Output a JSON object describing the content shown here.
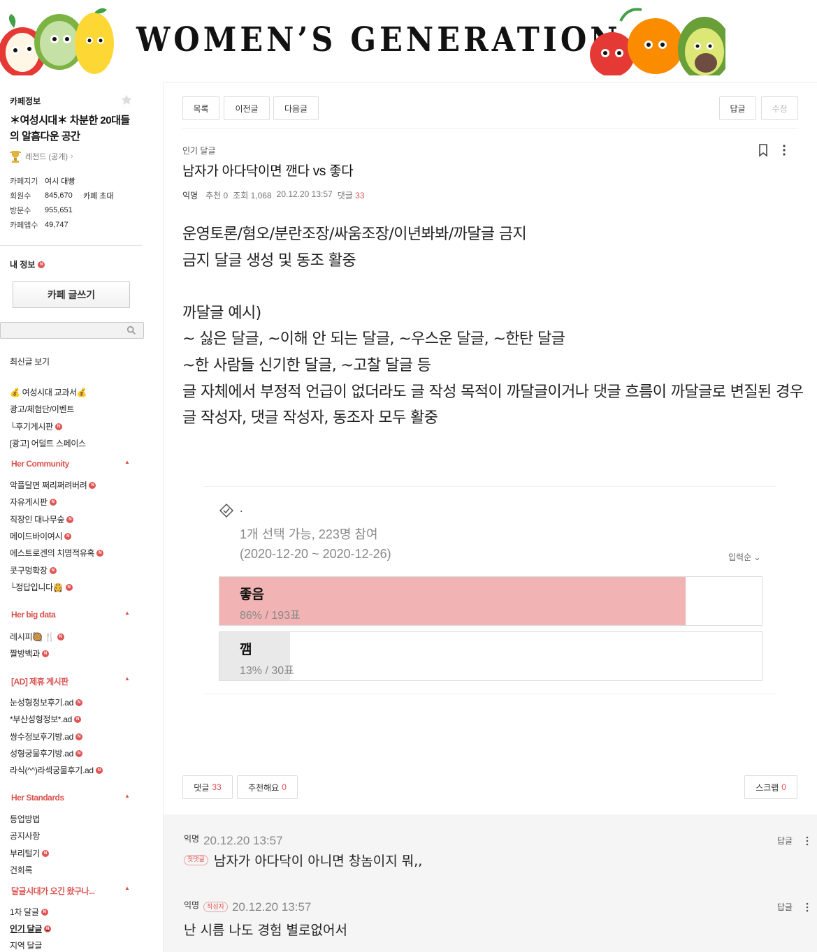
{
  "banner": {
    "title": "WOMEN’S GENERATION"
  },
  "sidebar": {
    "info_title": "카페정보",
    "cafe_name": "＊여성시대＊ 차분한 20대들의 알흠다운 공간",
    "legend": "레전드 (공개)",
    "stats": [
      {
        "label": "카페지기",
        "value": "여시 대빵",
        "extra": ""
      },
      {
        "label": "회원수",
        "value": "845,670",
        "extra": "카페 초대"
      },
      {
        "label": "방문수",
        "value": "955,651",
        "extra": ""
      },
      {
        "label": "카페앱수",
        "value": "49,747",
        "extra": ""
      }
    ],
    "my_info": "내 정보",
    "write_button": "카페 글쓰기",
    "latest": "최신글 보기",
    "links_top": [
      "💰 여성시대 교과서💰",
      "광고/체험단/이벤트",
      "└후기게시판",
      "[광고] 어덜트 스페이스"
    ],
    "group_her_community": "Her Community",
    "links_community": [
      "악플달면 쩌리쩌려버려",
      "자유게시판",
      "직장인 대나무숲",
      "메이드바이여시",
      "에스트로겐의 치명적유혹",
      "콧구멍확장",
      "└정답입니다👸"
    ],
    "group_her_big_data": "Her big data",
    "links_bigdata": [
      "레시피🥘 🍴",
      "짤방백과"
    ],
    "group_ad": "[AD] 제휴 게시판",
    "links_ad": [
      "눈성형정보후기.ad",
      "*부산성형정보*.ad",
      "쌍수정보후기방.ad",
      "성형궁물후기방.ad",
      "라식(^^)라섹궁물후기.ad"
    ],
    "group_standards": "Her Standards",
    "links_standards": [
      "등업방법",
      "공지사항",
      "부리털기",
      "건회록"
    ],
    "group_dalgeul": "달글시대가 오긴 왔구나...",
    "links_dalgeul": [
      "1차 달글",
      "인기 달글",
      "지역 달글"
    ],
    "n_badge": "N"
  },
  "toolbar": {
    "list": "목록",
    "prev": "이전글",
    "next": "다음글",
    "reply": "답글",
    "edit": "수정"
  },
  "post": {
    "board": "인기 달글",
    "title": "남자가 아다닥이면 깬다 vs 좋다",
    "author": "익명",
    "recommend": "추천 0",
    "views": "조회 1,068",
    "date": "20.12.20 13:57",
    "comments_label": "댓글",
    "comments_count": "33",
    "content": [
      "운영토론/혐오/분란조장/싸움조장/이년봐봐/까달글 금지",
      "금지 달글 생성 및 동조 활중",
      "",
      "까달글 예시)",
      "~ 싫은 달글, ~이해 안 되는 달글, ~우스운 달글, ~한탄 달글",
      "~한 사람들 신기한 달글, ~고찰 달글 등",
      "글 자체에서 부정적 언급이 없더라도 글 작성 목적이 까달글이거나 댓글 흐름이 까달글로 변질된 경우 글 작성자, 댓글 작성자, 동조자 모두 활중"
    ]
  },
  "poll": {
    "title": ".",
    "desc_line1": "1개 선택 가능, 223명 참여",
    "desc_line2": "(2020-12-20 ~ 2020-12-26)",
    "sort": "입력순",
    "options": [
      {
        "label": "좋음",
        "result": "86% / 193표",
        "fraction": 0.86,
        "color": "#f1b3b3"
      },
      {
        "label": "깸",
        "result": "13% / 30표",
        "fraction": 0.13,
        "color": "#e9e9e9"
      }
    ]
  },
  "actions": {
    "comment": "댓글",
    "comment_count": "33",
    "like": "추천해요",
    "like_count": "0",
    "scrap": "스크랩",
    "scrap_count": "0"
  },
  "comments": [
    {
      "author": "익명",
      "tag": "첫댓글",
      "date": "20.12.20 13:57",
      "text": "남자가 아다닥이 아니면 창놈이지 뭐,,",
      "reply": "답글",
      "tag_position": "body"
    },
    {
      "author": "익명",
      "tag": "작성자",
      "date": "20.12.20 13:57",
      "text": "난 시름 나도 경험 별로없어서",
      "reply": "답글",
      "tag_position": "head"
    }
  ]
}
